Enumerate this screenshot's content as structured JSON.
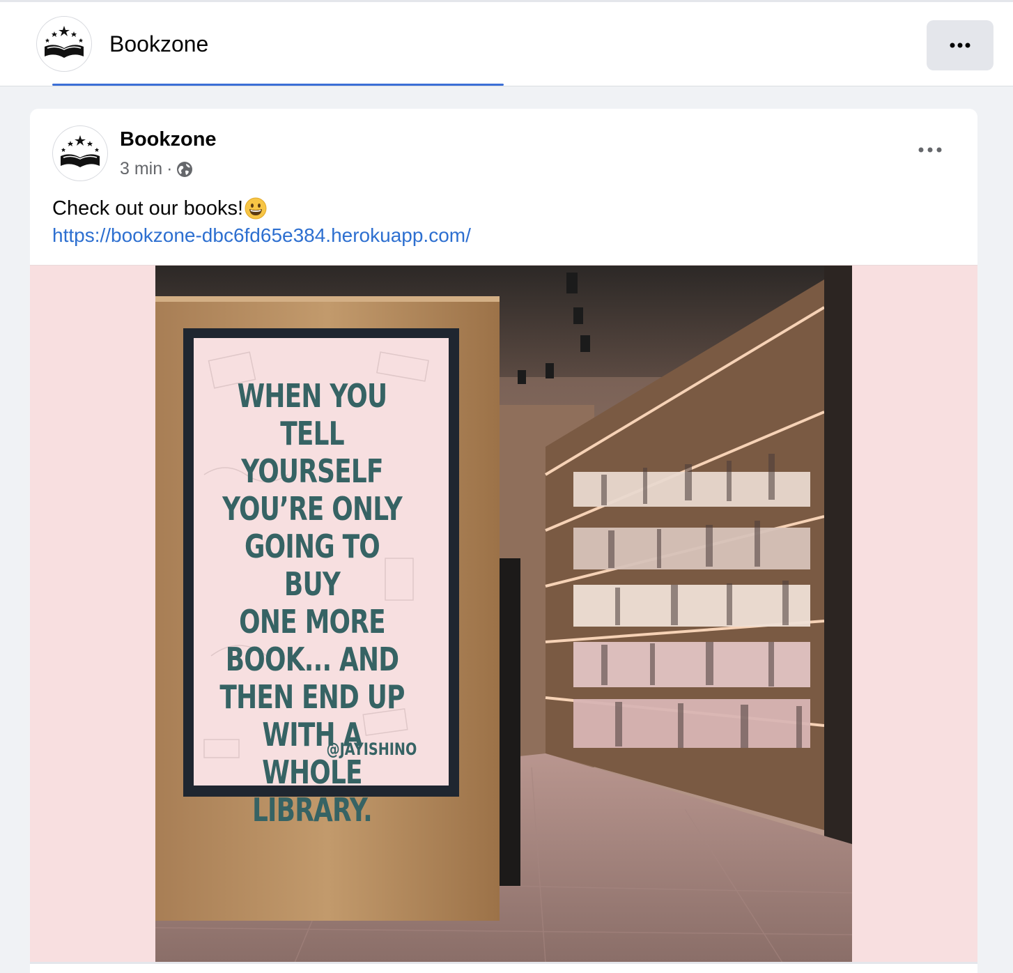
{
  "header": {
    "page_name": "Bookzone",
    "more_icon": "ellipsis-icon",
    "logo_icon": "book-stars-logo"
  },
  "post": {
    "author": "Bookzone",
    "time": "3 min",
    "separator": "·",
    "audience_icon": "globe-icon",
    "text": "Check out our books!",
    "emoji": "😃",
    "link": "https://bookzone-dbc6fd65e384.herokuapp.com/",
    "more_icon": "ellipsis-icon"
  },
  "image": {
    "quote": "WHEN YOU TELL\nYOURSELF\nYOU’RE ONLY\nGOING TO BUY\nONE MORE\nBOOK... AND\nTHEN END UP\nWITH A WHOLE\nLIBRARY.",
    "credit": "@JAYISHINO"
  },
  "colors": {
    "link": "#2d6fd0",
    "tab_indicator": "#3b6fd6",
    "media_background": "#f8dfe0",
    "quote_text": "#366364"
  }
}
